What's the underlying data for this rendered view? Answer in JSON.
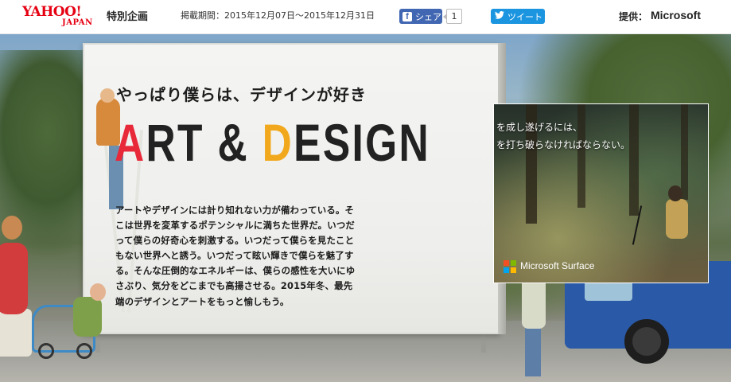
{
  "header": {
    "logo_text": "YAHOO!",
    "logo_subtext": "JAPAN",
    "special_label": "特別企画",
    "period": "掲載期間：2015年12月07日〜2015年12月31日",
    "facebook": {
      "label": "シェア",
      "count": "1"
    },
    "twitter": {
      "label": "ツイート"
    },
    "sponsor_label": "提供：",
    "sponsor_name": "Microsoft"
  },
  "hero": {
    "tagline": "やっぱり僕らは、デザインが好き",
    "headline": {
      "part1": "A",
      "part2": "RT & ",
      "part3": "D",
      "part4": "ESIGN"
    },
    "body_lines": [
      "アートやデザインには計り知れない力が備わっている。そ",
      "こは世界を変革するポテンシャルに満ちた世界だ。いつだ",
      "って僕らの好奇心を刺激する。いつだって僕らを見たこと",
      "もない世界へと誘う。いつだって眩い輝きで僕らを魅了す",
      "る。そんな圧倒的なエネルギーは、僕らの感性を大いにゆ",
      "さぶり、気分をどこまでも高揚させる。2015年冬、最先",
      "端のデザインとアートをもっと愉しもう。"
    ]
  },
  "ad": {
    "caption_line1": "を成し遂げるには、",
    "caption_line2": "を打ち破らなければならない。",
    "brand": "Microsoft Surface",
    "logo_colors": [
      "#f25022",
      "#7fba00",
      "#00a4ef",
      "#ffb900"
    ]
  },
  "colors": {
    "yahoo_red": "#e60012",
    "headline_red": "#e8293a",
    "headline_orange": "#f2a81d",
    "facebook_blue": "#4267b2",
    "twitter_blue": "#1b95e0"
  },
  "icons": {
    "facebook": "facebook-f-icon",
    "twitter": "twitter-bird-icon",
    "microsoft": "microsoft-windows-logo-icon"
  }
}
